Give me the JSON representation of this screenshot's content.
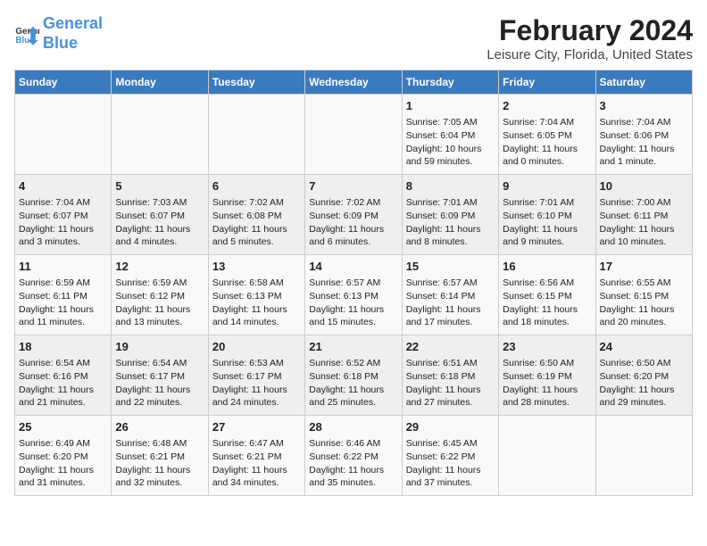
{
  "header": {
    "logo_line1": "General",
    "logo_line2": "Blue",
    "main_title": "February 2024",
    "sub_title": "Leisure City, Florida, United States"
  },
  "calendar": {
    "days_of_week": [
      "Sunday",
      "Monday",
      "Tuesday",
      "Wednesday",
      "Thursday",
      "Friday",
      "Saturday"
    ],
    "weeks": [
      [
        {
          "day": "",
          "info": ""
        },
        {
          "day": "",
          "info": ""
        },
        {
          "day": "",
          "info": ""
        },
        {
          "day": "",
          "info": ""
        },
        {
          "day": "1",
          "info": "Sunrise: 7:05 AM\nSunset: 6:04 PM\nDaylight: 10 hours and 59 minutes."
        },
        {
          "day": "2",
          "info": "Sunrise: 7:04 AM\nSunset: 6:05 PM\nDaylight: 11 hours and 0 minutes."
        },
        {
          "day": "3",
          "info": "Sunrise: 7:04 AM\nSunset: 6:06 PM\nDaylight: 11 hours and 1 minute."
        }
      ],
      [
        {
          "day": "4",
          "info": "Sunrise: 7:04 AM\nSunset: 6:07 PM\nDaylight: 11 hours and 3 minutes."
        },
        {
          "day": "5",
          "info": "Sunrise: 7:03 AM\nSunset: 6:07 PM\nDaylight: 11 hours and 4 minutes."
        },
        {
          "day": "6",
          "info": "Sunrise: 7:02 AM\nSunset: 6:08 PM\nDaylight: 11 hours and 5 minutes."
        },
        {
          "day": "7",
          "info": "Sunrise: 7:02 AM\nSunset: 6:09 PM\nDaylight: 11 hours and 6 minutes."
        },
        {
          "day": "8",
          "info": "Sunrise: 7:01 AM\nSunset: 6:09 PM\nDaylight: 11 hours and 8 minutes."
        },
        {
          "day": "9",
          "info": "Sunrise: 7:01 AM\nSunset: 6:10 PM\nDaylight: 11 hours and 9 minutes."
        },
        {
          "day": "10",
          "info": "Sunrise: 7:00 AM\nSunset: 6:11 PM\nDaylight: 11 hours and 10 minutes."
        }
      ],
      [
        {
          "day": "11",
          "info": "Sunrise: 6:59 AM\nSunset: 6:11 PM\nDaylight: 11 hours and 11 minutes."
        },
        {
          "day": "12",
          "info": "Sunrise: 6:59 AM\nSunset: 6:12 PM\nDaylight: 11 hours and 13 minutes."
        },
        {
          "day": "13",
          "info": "Sunrise: 6:58 AM\nSunset: 6:13 PM\nDaylight: 11 hours and 14 minutes."
        },
        {
          "day": "14",
          "info": "Sunrise: 6:57 AM\nSunset: 6:13 PM\nDaylight: 11 hours and 15 minutes."
        },
        {
          "day": "15",
          "info": "Sunrise: 6:57 AM\nSunset: 6:14 PM\nDaylight: 11 hours and 17 minutes."
        },
        {
          "day": "16",
          "info": "Sunrise: 6:56 AM\nSunset: 6:15 PM\nDaylight: 11 hours and 18 minutes."
        },
        {
          "day": "17",
          "info": "Sunrise: 6:55 AM\nSunset: 6:15 PM\nDaylight: 11 hours and 20 minutes."
        }
      ],
      [
        {
          "day": "18",
          "info": "Sunrise: 6:54 AM\nSunset: 6:16 PM\nDaylight: 11 hours and 21 minutes."
        },
        {
          "day": "19",
          "info": "Sunrise: 6:54 AM\nSunset: 6:17 PM\nDaylight: 11 hours and 22 minutes."
        },
        {
          "day": "20",
          "info": "Sunrise: 6:53 AM\nSunset: 6:17 PM\nDaylight: 11 hours and 24 minutes."
        },
        {
          "day": "21",
          "info": "Sunrise: 6:52 AM\nSunset: 6:18 PM\nDaylight: 11 hours and 25 minutes."
        },
        {
          "day": "22",
          "info": "Sunrise: 6:51 AM\nSunset: 6:18 PM\nDaylight: 11 hours and 27 minutes."
        },
        {
          "day": "23",
          "info": "Sunrise: 6:50 AM\nSunset: 6:19 PM\nDaylight: 11 hours and 28 minutes."
        },
        {
          "day": "24",
          "info": "Sunrise: 6:50 AM\nSunset: 6:20 PM\nDaylight: 11 hours and 29 minutes."
        }
      ],
      [
        {
          "day": "25",
          "info": "Sunrise: 6:49 AM\nSunset: 6:20 PM\nDaylight: 11 hours and 31 minutes."
        },
        {
          "day": "26",
          "info": "Sunrise: 6:48 AM\nSunset: 6:21 PM\nDaylight: 11 hours and 32 minutes."
        },
        {
          "day": "27",
          "info": "Sunrise: 6:47 AM\nSunset: 6:21 PM\nDaylight: 11 hours and 34 minutes."
        },
        {
          "day": "28",
          "info": "Sunrise: 6:46 AM\nSunset: 6:22 PM\nDaylight: 11 hours and 35 minutes."
        },
        {
          "day": "29",
          "info": "Sunrise: 6:45 AM\nSunset: 6:22 PM\nDaylight: 11 hours and 37 minutes."
        },
        {
          "day": "",
          "info": ""
        },
        {
          "day": "",
          "info": ""
        }
      ]
    ]
  }
}
